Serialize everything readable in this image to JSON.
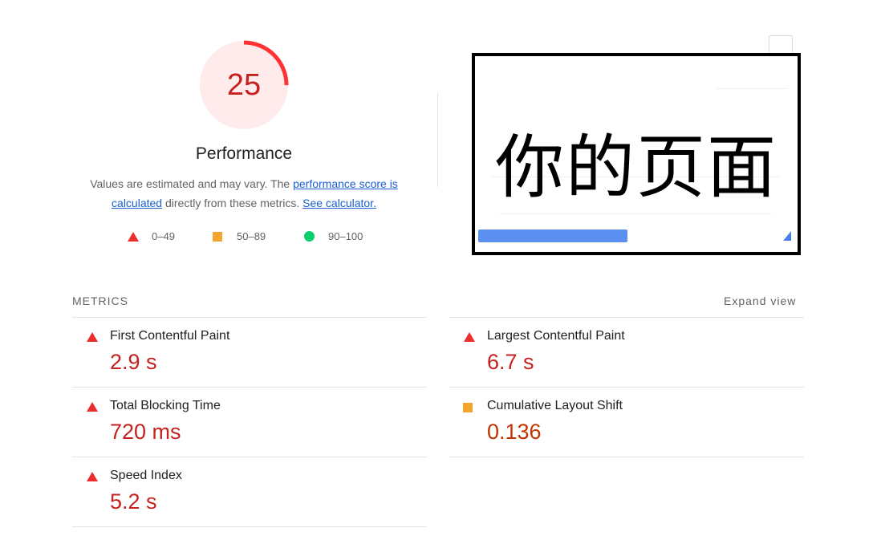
{
  "gauge": {
    "score": "25",
    "score_fraction": 0.25,
    "color": "#ff3333",
    "bg": "#ffebeb"
  },
  "title": "Performance",
  "description": {
    "text1": "Values are estimated and may vary. The ",
    "link1": "performance score is calculated",
    "text2": " directly from these metrics. ",
    "link2": "See calculator."
  },
  "legend": [
    {
      "icon": "red-triangle-icon",
      "label": "0–49"
    },
    {
      "icon": "orange-square-icon",
      "label": "50–89"
    },
    {
      "icon": "green-circle-icon",
      "label": "90–100"
    }
  ],
  "screenshot": {
    "text": "你的页面"
  },
  "metrics_section": {
    "heading": "METRICS",
    "expand_label": "Expand view",
    "items": [
      {
        "label": "First Contentful Paint",
        "value": "2.9 s",
        "rating": "poor"
      },
      {
        "label": "Largest Contentful Paint",
        "value": "6.7 s",
        "rating": "poor"
      },
      {
        "label": "Total Blocking Time",
        "value": "720 ms",
        "rating": "poor"
      },
      {
        "label": "Cumulative Layout Shift",
        "value": "0.136",
        "rating": "average"
      },
      {
        "label": "Speed Index",
        "value": "5.2 s",
        "rating": "poor"
      }
    ]
  },
  "colors": {
    "fail": "#c5221f",
    "average": "#c33300",
    "link": "#1a5fd0"
  }
}
